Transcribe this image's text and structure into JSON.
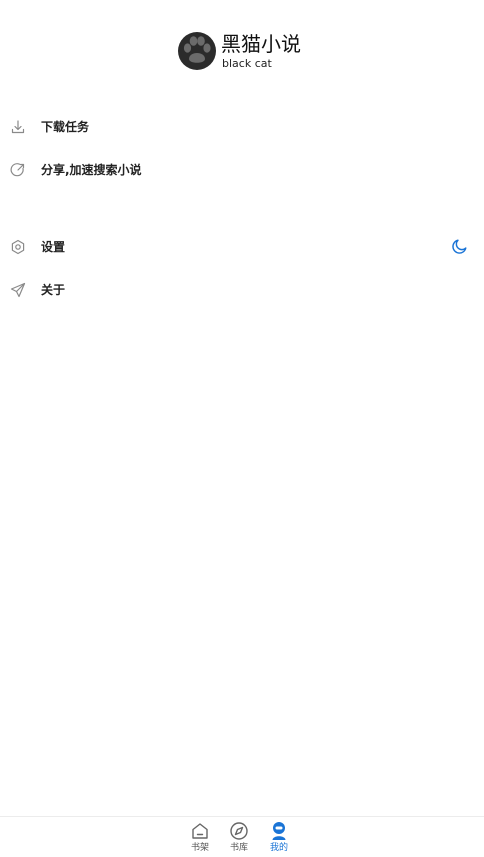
{
  "app": {
    "title": "黑猫小说",
    "subtitle": "black cat",
    "logo_icon": "paw-icon"
  },
  "menu": {
    "download": {
      "label": "下载任务",
      "icon": "download-icon"
    },
    "share": {
      "label": "分享,加速搜索小说",
      "icon": "share-icon"
    },
    "settings": {
      "label": "设置",
      "icon": "hexagon-settings-icon",
      "night_mode_icon": "moon-icon"
    },
    "about": {
      "label": "关于",
      "icon": "paper-plane-icon"
    }
  },
  "tabs": [
    {
      "label": "书架",
      "icon": "home-icon",
      "active": false
    },
    {
      "label": "书库",
      "icon": "compass-icon",
      "active": false
    },
    {
      "label": "我的",
      "icon": "user-icon",
      "active": true
    }
  ],
  "colors": {
    "accent": "#1a74d6",
    "text": "#222222",
    "icon_gray": "#8a8a8a"
  }
}
